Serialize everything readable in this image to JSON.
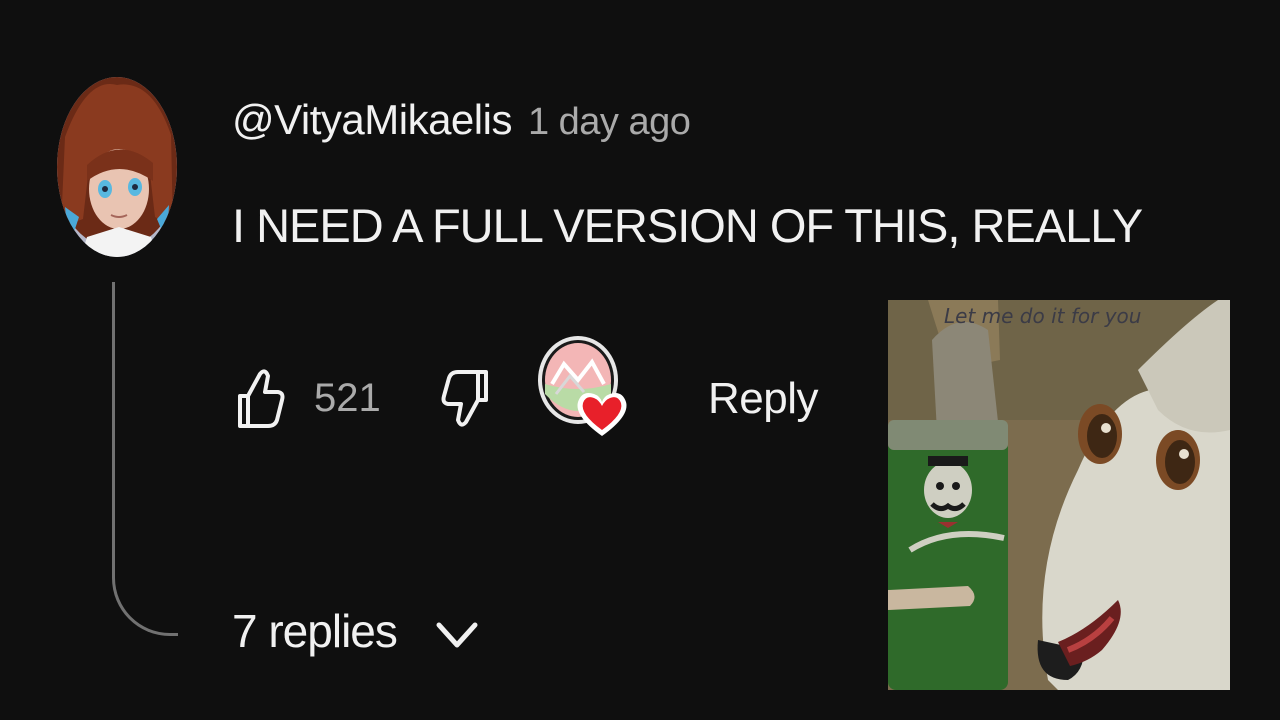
{
  "comment": {
    "author": "@VityaMikaelis",
    "timestamp": "1 day ago",
    "text": "I NEED A FULL VERSION OF THIS, REALLY"
  },
  "actions": {
    "like_count": "521",
    "reply_label": "Reply",
    "like_icon": "thumbs-up-icon",
    "dislike_icon": "thumbs-down-icon",
    "heart_icon": "creator-heart-icon"
  },
  "replies": {
    "label": "7 replies",
    "chevron_icon": "chevron-down-icon"
  },
  "meme": {
    "caption": "Let me do it for you"
  },
  "colors": {
    "background": "#0f0f0f",
    "primary_text": "#f1f1f1",
    "secondary_text": "#aaaaaa",
    "heart": "#e8202a"
  }
}
